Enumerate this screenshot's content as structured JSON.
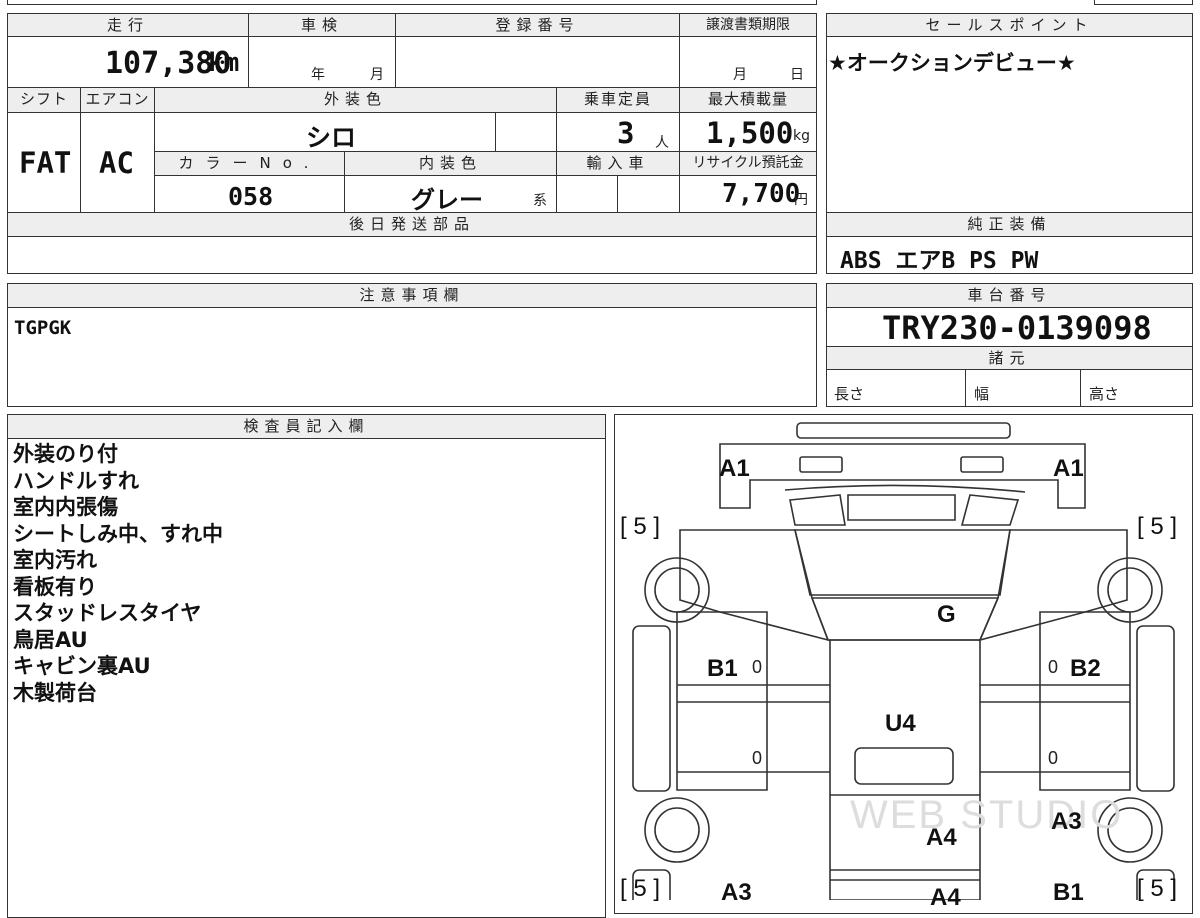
{
  "mileage": {
    "label": "走行",
    "value": "107,380",
    "unit": "km"
  },
  "inspection": {
    "label": "車検",
    "year_unit": "年",
    "month_unit": "月"
  },
  "registration": {
    "label": "登録番号"
  },
  "transfer_deadline": {
    "label": "譲渡書類期限",
    "month_unit": "月",
    "day_unit": "日"
  },
  "sales_point": {
    "label": "セールスポイント",
    "text": "★オークションデビュー★"
  },
  "shift": {
    "label": "シフト",
    "value": "FAT"
  },
  "aircon": {
    "label": "エアコン",
    "value": "AC"
  },
  "exterior_color": {
    "label": "外装色",
    "value": "シロ"
  },
  "capacity": {
    "label": "乗車定員",
    "value": "3",
    "unit": "人"
  },
  "max_load": {
    "label": "最大積載量",
    "value": "1,500",
    "unit": "kg"
  },
  "color_no": {
    "label": "カラーNo.",
    "value": "058"
  },
  "interior_color": {
    "label": "内装色",
    "value": "グレー",
    "suffix": "系"
  },
  "import": {
    "label": "輸入車"
  },
  "recycle_fee": {
    "label": "リサイクル預託金",
    "value": "7,700",
    "unit": "円"
  },
  "later_parts": {
    "label": "後日発送部品"
  },
  "equipment": {
    "label": "純正装備",
    "value": "ABS エアB PS PW"
  },
  "notes_section": {
    "label": "注意事項欄",
    "text": "TGPGK"
  },
  "chassis": {
    "label": "車台番号",
    "value": "TRY230-0139098"
  },
  "specs": {
    "label": "諸元",
    "length": "長さ",
    "width": "幅",
    "height": "高さ"
  },
  "inspector": {
    "label": "検査員記入欄",
    "notes": [
      "外装のり付",
      "ハンドルすれ",
      "室内内張傷",
      "シートしみ中、すれ中",
      "室内汚れ",
      "看板有り",
      "スタッドレスタイヤ",
      "鳥居AU",
      "キャビン裏AU",
      "木製荷台"
    ]
  },
  "diagram": {
    "tire_depth": "[ 5 ]",
    "marks": {
      "a1_left": "A1",
      "a1_right": "A1",
      "g": "G",
      "b1": "B1",
      "b2": "B2",
      "u4": "U4",
      "a4_upper": "A4",
      "a3_right": "A3",
      "a3_left": "A3",
      "a4_lower": "A4",
      "b1_lower": "B1"
    },
    "zero": "0",
    "watermark": "WEB STUDIO"
  }
}
